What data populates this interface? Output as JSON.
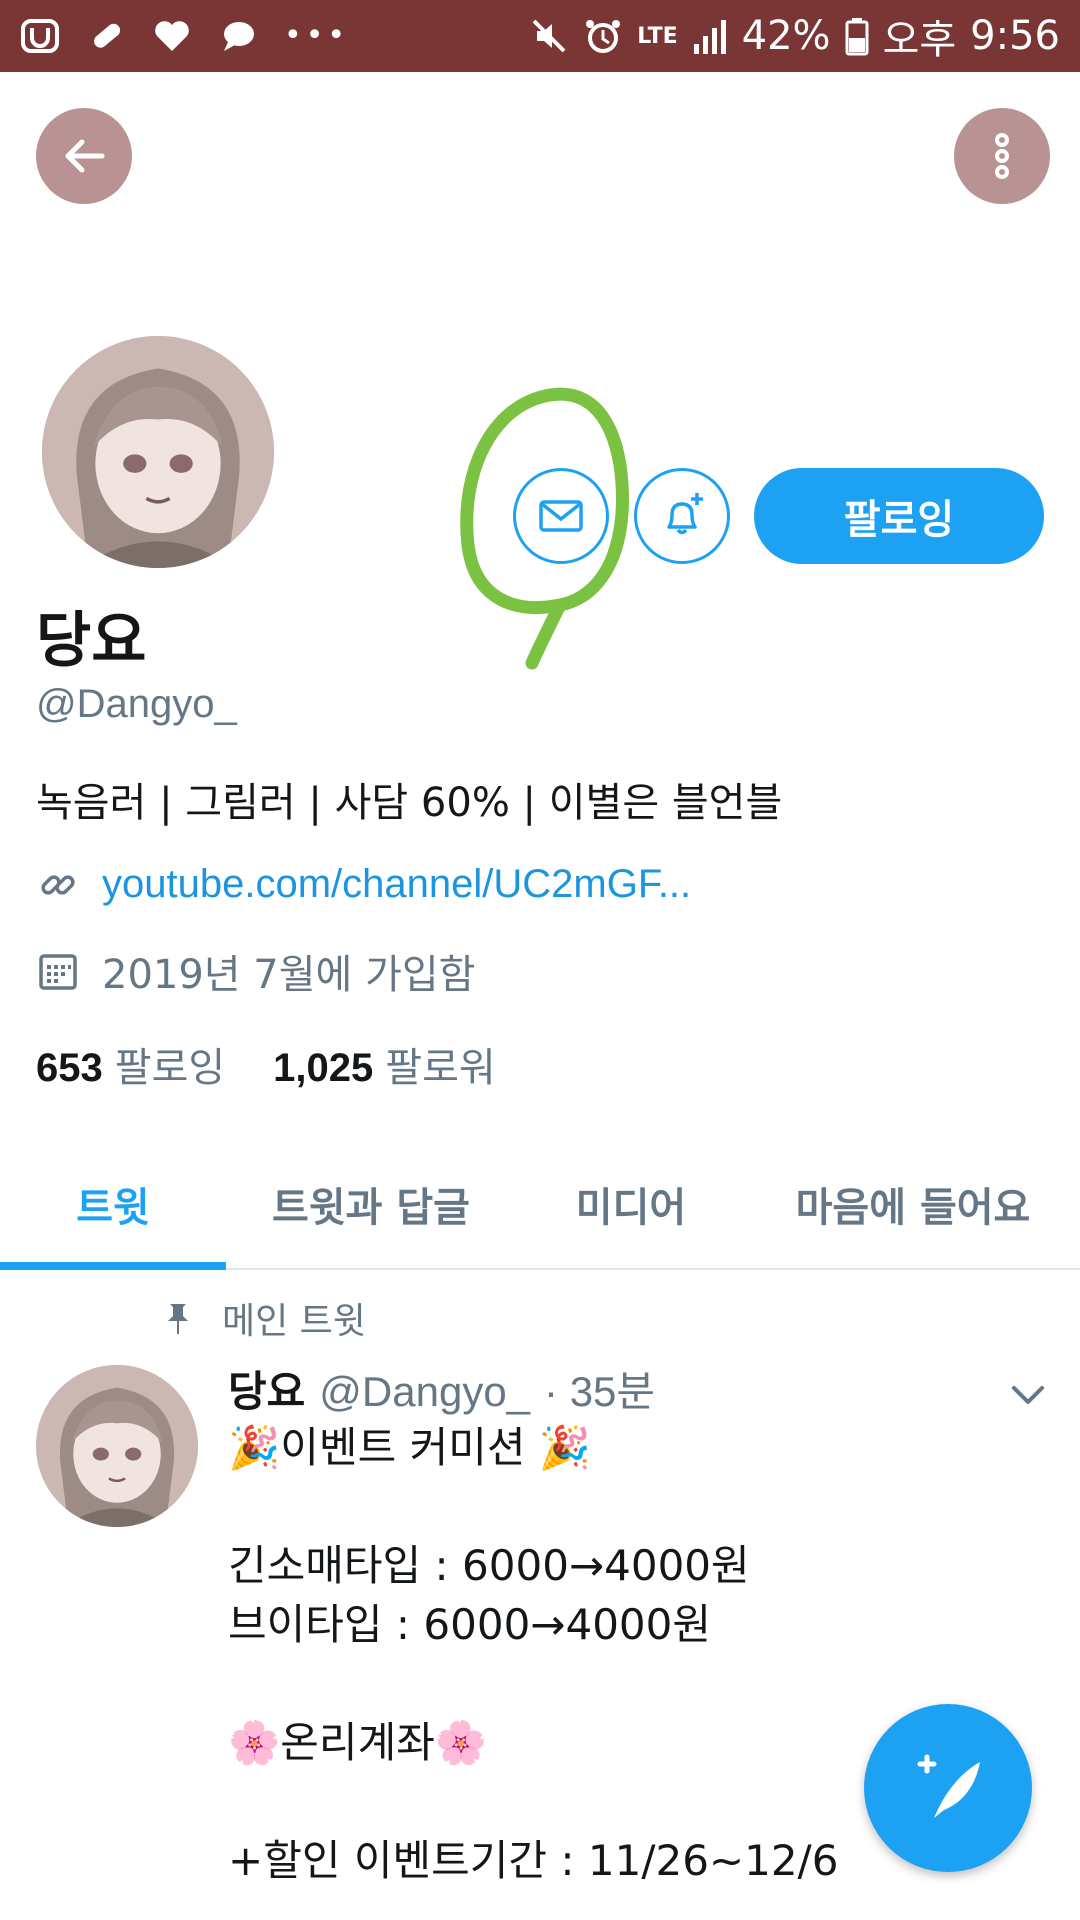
{
  "status_bar": {
    "battery": "42%",
    "period": "오후",
    "time": "9:56",
    "network": "LTE"
  },
  "profile": {
    "display_name": "당요",
    "handle": "@Dangyo_",
    "bio": "녹음러 | 그림러 | 사담 60% | 이별은 블언블",
    "link": "youtube.com/channel/UC2mGF...",
    "joined": "2019년 7월에 가입함",
    "following_count": "653",
    "following_label": "팔로잉",
    "followers_count": "1,025",
    "followers_label": "팔로워",
    "follow_button": "팔로잉"
  },
  "tabs": [
    {
      "label": "트윗",
      "active": true
    },
    {
      "label": "트윗과 답글",
      "active": false
    },
    {
      "label": "미디어",
      "active": false
    },
    {
      "label": "마음에 들어요",
      "active": false
    }
  ],
  "tweet": {
    "pinned_label": "메인 트윗",
    "author_name": "당요",
    "author_handle": "@Dangyo_",
    "time": "· 35분",
    "lines": [
      "🎉이벤트 커미션 🎉",
      "",
      "긴소매타입 : 6000→4000원",
      "브이타입 : 6000→4000원",
      "",
      "🌸온리계좌🌸",
      "",
      "+할인 이벤트기간 : 11/26~12/6"
    ]
  },
  "colors": {
    "accent": "#1da1f2",
    "status_bar": "#7a3535",
    "header_button": "#b99393",
    "annotation": "#7cc242"
  },
  "icons": {
    "back": "arrow-left-icon",
    "more": "more-vertical-icon",
    "dm": "mail-icon",
    "notify": "bell-plus-icon",
    "link": "link-icon",
    "calendar": "calendar-icon",
    "pin": "pin-icon",
    "chevron": "chevron-down-icon",
    "compose": "compose-feather-icon"
  }
}
